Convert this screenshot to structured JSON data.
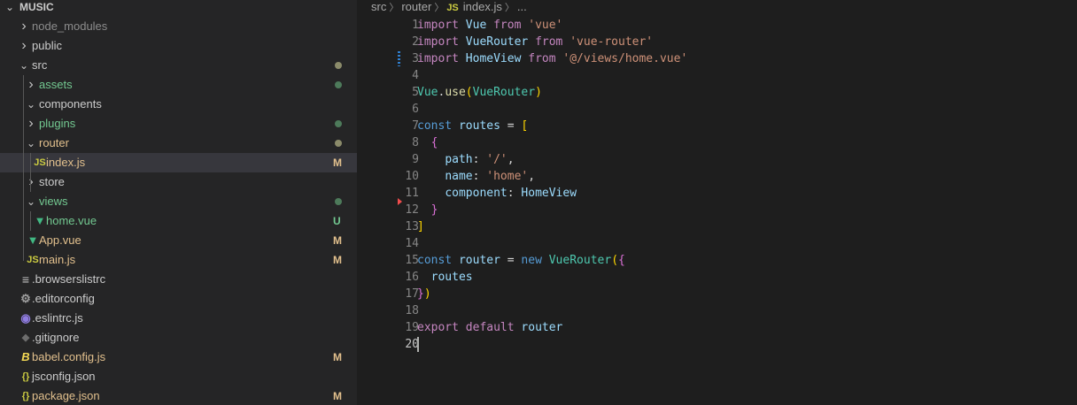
{
  "explorer": {
    "root_label": "MUSIC",
    "items": [
      {
        "label": "node_modules",
        "kind": "folder",
        "expanded": false,
        "depth": 1,
        "color": "#8c8c8c"
      },
      {
        "label": "public",
        "kind": "folder",
        "expanded": false,
        "depth": 1,
        "color": "#cccccc"
      },
      {
        "label": "src",
        "kind": "folder",
        "expanded": true,
        "depth": 1,
        "color": "#cccccc",
        "dot": "#8b8b6a"
      },
      {
        "label": "assets",
        "kind": "folder",
        "expanded": false,
        "depth": 2,
        "color": "#73c991",
        "dot": "#4d7a5a"
      },
      {
        "label": "components",
        "kind": "folder",
        "expanded": true,
        "depth": 2,
        "color": "#cccccc"
      },
      {
        "label": "plugins",
        "kind": "folder",
        "expanded": false,
        "depth": 2,
        "color": "#73c991",
        "dot": "#4d7a5a"
      },
      {
        "label": "router",
        "kind": "folder",
        "expanded": true,
        "depth": 2,
        "color": "#e2c08d",
        "dot": "#8b8b6a"
      },
      {
        "label": "index.js",
        "kind": "file",
        "icon": "js",
        "depth": 3,
        "color": "#e2c08d",
        "badge": "M",
        "selected": true
      },
      {
        "label": "store",
        "kind": "folder",
        "expanded": false,
        "depth": 2,
        "color": "#cccccc"
      },
      {
        "label": "views",
        "kind": "folder",
        "expanded": true,
        "depth": 2,
        "color": "#73c991",
        "dot": "#4d7a5a"
      },
      {
        "label": "home.vue",
        "kind": "file",
        "icon": "vue",
        "depth": 3,
        "color": "#73c991",
        "badge": "U"
      },
      {
        "label": "App.vue",
        "kind": "file",
        "icon": "vue",
        "depth": 2,
        "color": "#e2c08d",
        "badge": "M"
      },
      {
        "label": "main.js",
        "kind": "file",
        "icon": "js",
        "depth": 2,
        "color": "#e2c08d",
        "badge": "M"
      },
      {
        "label": ".browserslistrc",
        "kind": "file",
        "icon": "lines",
        "depth": 1,
        "color": "#cccccc"
      },
      {
        "label": ".editorconfig",
        "kind": "file",
        "icon": "gear",
        "depth": 1,
        "color": "#cccccc"
      },
      {
        "label": ".eslintrc.js",
        "kind": "file",
        "icon": "eslint",
        "depth": 1,
        "color": "#cccccc"
      },
      {
        "label": ".gitignore",
        "kind": "file",
        "icon": "git",
        "depth": 1,
        "color": "#cccccc"
      },
      {
        "label": "babel.config.js",
        "kind": "file",
        "icon": "babel",
        "depth": 1,
        "color": "#e2c08d",
        "badge": "M"
      },
      {
        "label": "jsconfig.json",
        "kind": "file",
        "icon": "json",
        "depth": 1,
        "color": "#cccccc"
      },
      {
        "label": "package.json",
        "kind": "file",
        "icon": "json",
        "depth": 1,
        "color": "#e2c08d",
        "badge": "M"
      }
    ]
  },
  "breadcrumb": {
    "parts": [
      "src",
      "router"
    ],
    "file_badge": "JS",
    "file": "index.js",
    "more": "..."
  },
  "editor": {
    "current_line": 20,
    "lines": [
      [
        [
          "import ",
          "kw"
        ],
        [
          "Vue",
          "var"
        ],
        [
          " from ",
          "kw"
        ],
        [
          "'vue'",
          "str"
        ]
      ],
      [
        [
          "import ",
          "kw"
        ],
        [
          "VueRouter",
          "var"
        ],
        [
          " from ",
          "kw"
        ],
        [
          "'vue-router'",
          "str"
        ]
      ],
      [
        [
          "import ",
          "kw"
        ],
        [
          "HomeView",
          "var"
        ],
        [
          " from ",
          "kw"
        ],
        [
          "'@/views/home.vue'",
          "str"
        ]
      ],
      [],
      [
        [
          "Vue",
          "cls"
        ],
        [
          ".",
          "pun"
        ],
        [
          "use",
          "fn"
        ],
        [
          "(",
          "br1"
        ],
        [
          "VueRouter",
          "cls"
        ],
        [
          ")",
          "br1"
        ]
      ],
      [],
      [
        [
          "const ",
          "decl"
        ],
        [
          "routes",
          "var"
        ],
        [
          " = ",
          "pun"
        ],
        [
          "[",
          "br1"
        ]
      ],
      [
        [
          "  ",
          "pun"
        ],
        [
          "{",
          "br2"
        ]
      ],
      [
        [
          "    ",
          "pun"
        ],
        [
          "path",
          "prop"
        ],
        [
          ": ",
          "pun"
        ],
        [
          "'/'",
          "str"
        ],
        [
          ",",
          "pun"
        ]
      ],
      [
        [
          "    ",
          "pun"
        ],
        [
          "name",
          "prop"
        ],
        [
          ": ",
          "pun"
        ],
        [
          "'home'",
          "str"
        ],
        [
          ",",
          "pun"
        ]
      ],
      [
        [
          "    ",
          "pun"
        ],
        [
          "component",
          "prop"
        ],
        [
          ": ",
          "pun"
        ],
        [
          "HomeView",
          "var"
        ]
      ],
      [
        [
          "  ",
          "pun"
        ],
        [
          "}",
          "br2"
        ]
      ],
      [
        [
          "]",
          "br1"
        ]
      ],
      [],
      [
        [
          "const ",
          "decl"
        ],
        [
          "router",
          "var"
        ],
        [
          " = ",
          "pun"
        ],
        [
          "new ",
          "decl"
        ],
        [
          "VueRouter",
          "cls"
        ],
        [
          "(",
          "br1"
        ],
        [
          "{",
          "br2"
        ]
      ],
      [
        [
          "  ",
          "pun"
        ],
        [
          "routes",
          "var"
        ]
      ],
      [
        [
          "}",
          "br2"
        ],
        [
          ")",
          "br1"
        ]
      ],
      [],
      [
        [
          "export ",
          "kw"
        ],
        [
          "default ",
          "kw"
        ],
        [
          "router",
          "var"
        ]
      ],
      []
    ]
  },
  "colors": {
    "sidebar_bg": "#252526",
    "editor_bg": "#1e1e1e",
    "selection_bg": "#37373d",
    "modified": "#e2c08d",
    "untracked": "#73c991"
  }
}
